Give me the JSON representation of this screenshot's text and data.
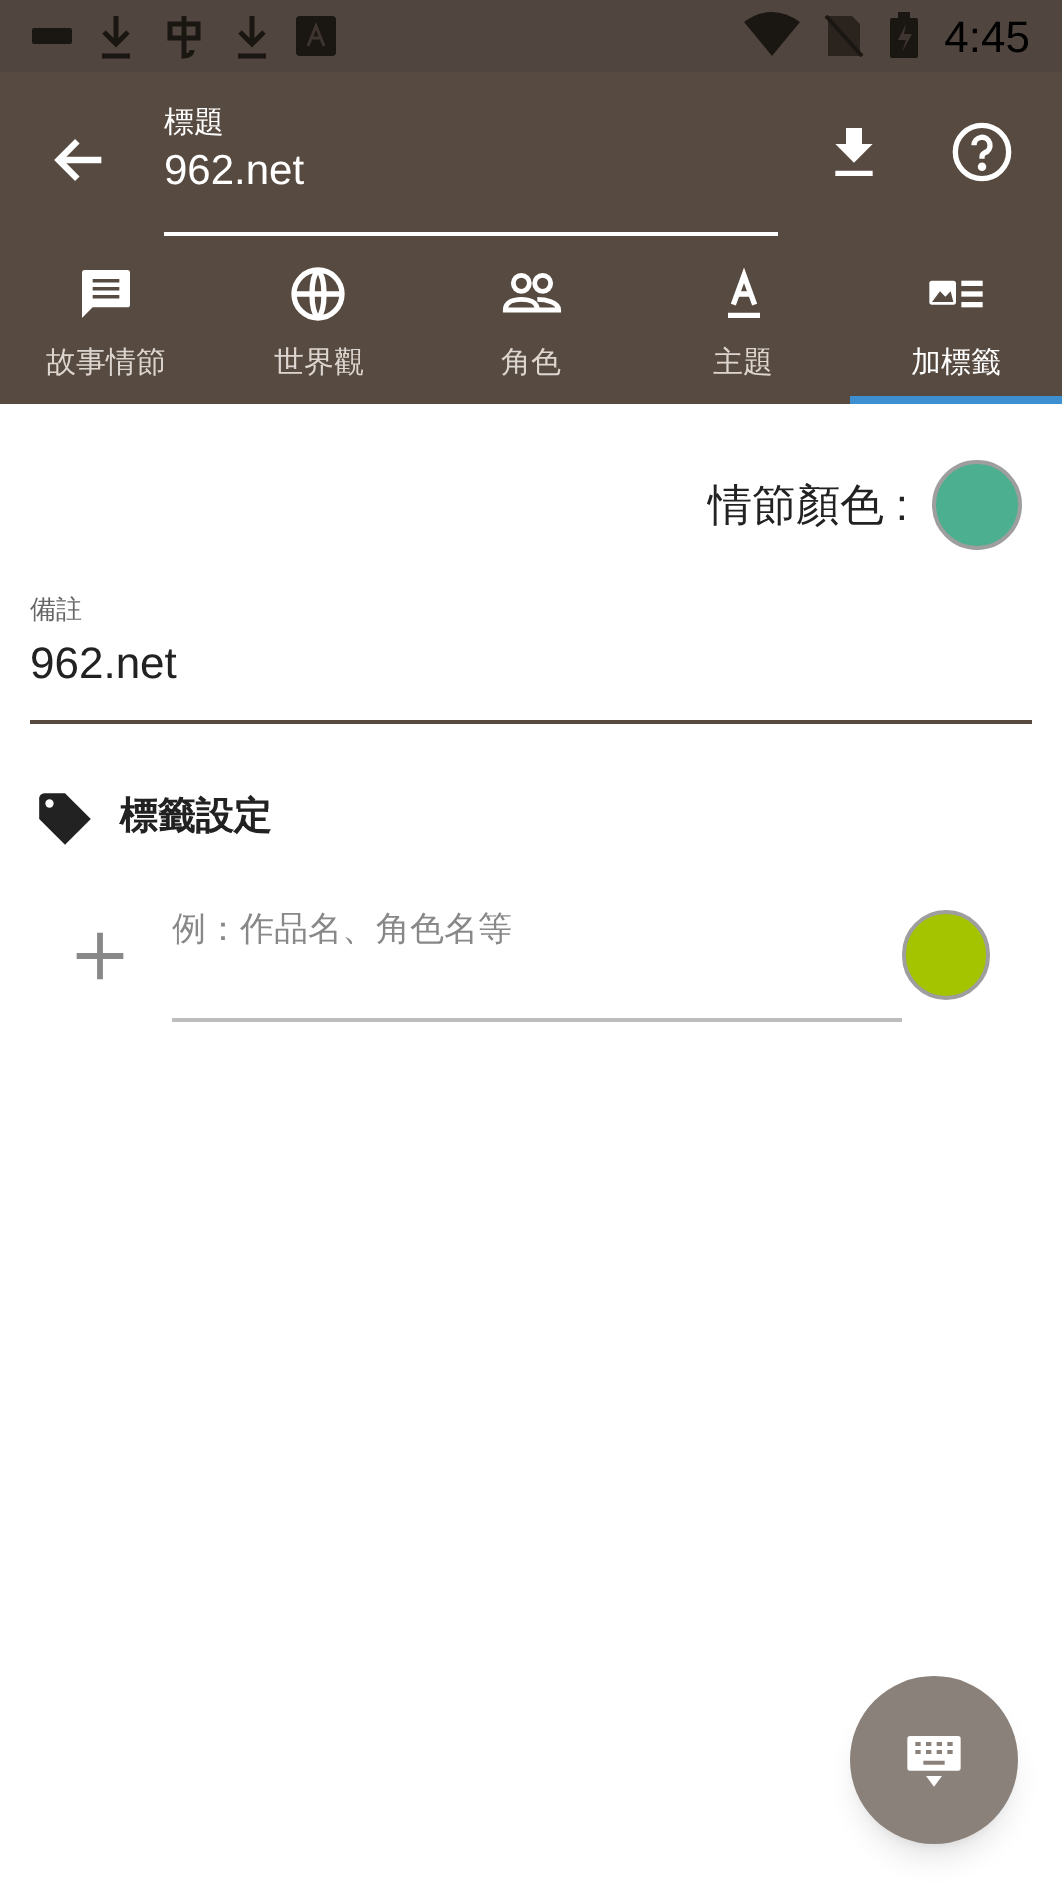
{
  "status_bar": {
    "time": "4:45"
  },
  "header": {
    "title_label": "標題",
    "title_value": "962.net"
  },
  "tabs": [
    {
      "label": "故事情節",
      "selected": false
    },
    {
      "label": "世界觀",
      "selected": false
    },
    {
      "label": "角色",
      "selected": false
    },
    {
      "label": "主題",
      "selected": false
    },
    {
      "label": "加標籤",
      "selected": true
    }
  ],
  "plot_color": {
    "label": "情節顏色 :",
    "color": "#4caf8f"
  },
  "note": {
    "label": "備註",
    "value": "962.net"
  },
  "tag_section": {
    "title": "標籤設定",
    "new_tag": {
      "placeholder": "例：作品名、角色名等",
      "color": "#a4c400"
    }
  }
}
